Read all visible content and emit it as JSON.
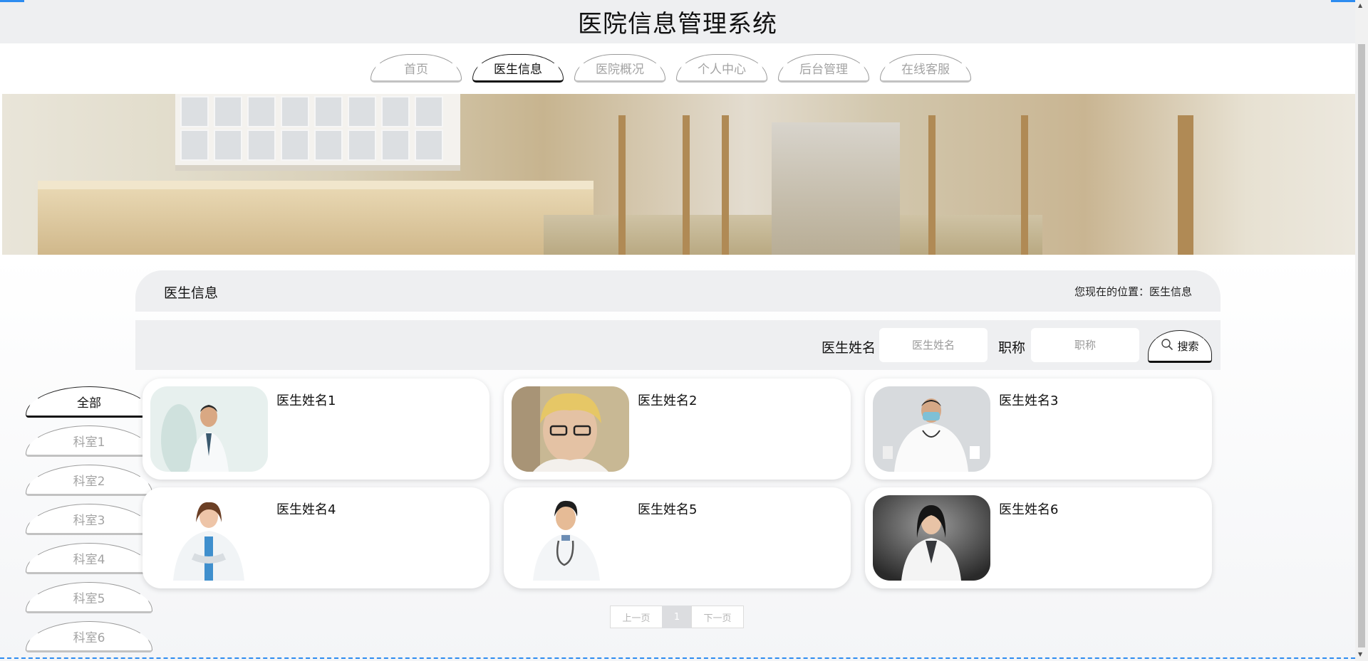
{
  "header": {
    "title": "医院信息管理系统"
  },
  "nav": {
    "tabs": [
      {
        "label": "首页",
        "active": false
      },
      {
        "label": "医生信息",
        "active": true
      },
      {
        "label": "医院概况",
        "active": false
      },
      {
        "label": "个人中心",
        "active": false
      },
      {
        "label": "后台管理",
        "active": false
      },
      {
        "label": "在线客服",
        "active": false
      }
    ]
  },
  "section": {
    "title": "医生信息",
    "breadcrumb": "您现在的位置：医生信息"
  },
  "search": {
    "name_label": "医生姓名",
    "name_placeholder": "医生姓名",
    "name_value": "",
    "title_label": "职称",
    "title_placeholder": "职称",
    "title_value": "",
    "button_label": "搜索",
    "button_icon": "search-icon"
  },
  "departments": [
    {
      "label": "全部",
      "active": true
    },
    {
      "label": "科室1",
      "active": false
    },
    {
      "label": "科室2",
      "active": false
    },
    {
      "label": "科室3",
      "active": false
    },
    {
      "label": "科室4",
      "active": false
    },
    {
      "label": "科室5",
      "active": false
    },
    {
      "label": "科室6",
      "active": false
    }
  ],
  "doctors": [
    {
      "name": "医生姓名1"
    },
    {
      "name": "医生姓名2"
    },
    {
      "name": "医生姓名3"
    },
    {
      "name": "医生姓名4"
    },
    {
      "name": "医生姓名5"
    },
    {
      "name": "医生姓名6"
    }
  ],
  "pagination": {
    "prev": "上一页",
    "current": "1",
    "next": "下一页"
  },
  "colors": {
    "accent": "#2d8cf0",
    "panel_bg": "#eeeff1",
    "inactive_text": "#a3a3a3"
  }
}
